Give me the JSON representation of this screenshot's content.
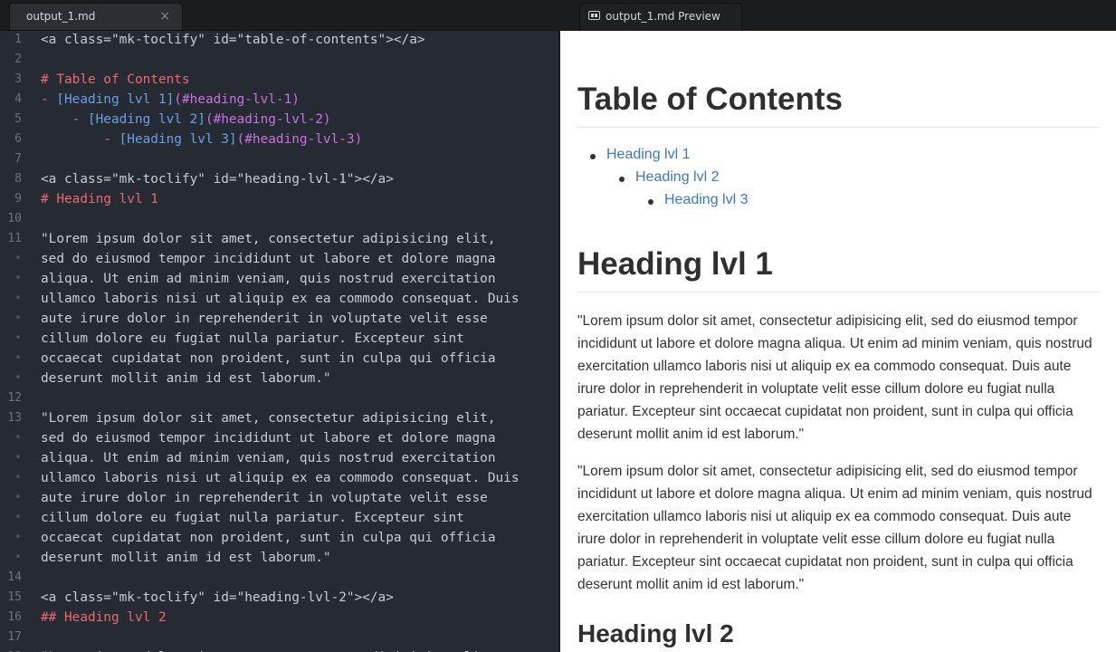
{
  "tabs": {
    "left": {
      "label": "output_1.md",
      "close": "×"
    },
    "right": {
      "label": "output_1.md Preview"
    }
  },
  "editor": {
    "lines": [
      {
        "n": "1",
        "segs": [
          [
            "text",
            "<a class=\"mk-toclify\" id=\"table-of-contents\"></a>"
          ]
        ]
      },
      {
        "n": "2",
        "segs": []
      },
      {
        "n": "3",
        "segs": [
          [
            "head",
            "# Table of Contents"
          ]
        ]
      },
      {
        "n": "4",
        "segs": [
          [
            "bullet",
            "- "
          ],
          [
            "link",
            "[Heading lvl 1]"
          ],
          [
            "url",
            "(#heading-lvl-1)"
          ]
        ]
      },
      {
        "n": "5",
        "segs": [
          [
            "text",
            "    "
          ],
          [
            "bullet",
            "- "
          ],
          [
            "link",
            "[Heading lvl 2]"
          ],
          [
            "url",
            "(#heading-lvl-2)"
          ]
        ]
      },
      {
        "n": "6",
        "segs": [
          [
            "text",
            "        "
          ],
          [
            "bullet",
            "- "
          ],
          [
            "link",
            "[Heading lvl 3]"
          ],
          [
            "url",
            "(#heading-lvl-3)"
          ]
        ]
      },
      {
        "n": "7",
        "segs": []
      },
      {
        "n": "8",
        "segs": [
          [
            "text",
            "<a class=\"mk-toclify\" id=\"heading-lvl-1\"></a>"
          ]
        ]
      },
      {
        "n": "9",
        "segs": [
          [
            "head",
            "# Heading lvl 1"
          ]
        ]
      },
      {
        "n": "10",
        "segs": []
      },
      {
        "n": "11",
        "segs": [
          [
            "text",
            "\"Lorem ipsum dolor sit amet, consectetur adipisicing elit,"
          ]
        ]
      },
      {
        "n": "•",
        "segs": [
          [
            "text",
            "sed do eiusmod tempor incididunt ut labore et dolore magna"
          ]
        ]
      },
      {
        "n": "•",
        "segs": [
          [
            "text",
            "aliqua. Ut enim ad minim veniam, quis nostrud exercitation"
          ]
        ]
      },
      {
        "n": "•",
        "segs": [
          [
            "text",
            "ullamco laboris nisi ut aliquip ex ea commodo consequat. Duis"
          ]
        ]
      },
      {
        "n": "•",
        "segs": [
          [
            "text",
            "aute irure dolor in reprehenderit in voluptate velit esse"
          ]
        ]
      },
      {
        "n": "•",
        "segs": [
          [
            "text",
            "cillum dolore eu fugiat nulla pariatur. Excepteur sint"
          ]
        ]
      },
      {
        "n": "•",
        "segs": [
          [
            "text",
            "occaecat cupidatat non proident, sunt in culpa qui officia"
          ]
        ]
      },
      {
        "n": "•",
        "segs": [
          [
            "text",
            "deserunt mollit anim id est laborum.\""
          ]
        ]
      },
      {
        "n": "12",
        "segs": []
      },
      {
        "n": "13",
        "segs": [
          [
            "text",
            "\"Lorem ipsum dolor sit amet, consectetur adipisicing elit,"
          ]
        ]
      },
      {
        "n": "•",
        "segs": [
          [
            "text",
            "sed do eiusmod tempor incididunt ut labore et dolore magna"
          ]
        ]
      },
      {
        "n": "•",
        "segs": [
          [
            "text",
            "aliqua. Ut enim ad minim veniam, quis nostrud exercitation"
          ]
        ]
      },
      {
        "n": "•",
        "segs": [
          [
            "text",
            "ullamco laboris nisi ut aliquip ex ea commodo consequat. Duis"
          ]
        ]
      },
      {
        "n": "•",
        "segs": [
          [
            "text",
            "aute irure dolor in reprehenderit in voluptate velit esse"
          ]
        ]
      },
      {
        "n": "•",
        "segs": [
          [
            "text",
            "cillum dolore eu fugiat nulla pariatur. Excepteur sint"
          ]
        ]
      },
      {
        "n": "•",
        "segs": [
          [
            "text",
            "occaecat cupidatat non proident, sunt in culpa qui officia"
          ]
        ]
      },
      {
        "n": "•",
        "segs": [
          [
            "text",
            "deserunt mollit anim id est laborum.\""
          ]
        ]
      },
      {
        "n": "14",
        "segs": []
      },
      {
        "n": "15",
        "segs": [
          [
            "text",
            "<a class=\"mk-toclify\" id=\"heading-lvl-2\"></a>"
          ]
        ]
      },
      {
        "n": "16",
        "segs": [
          [
            "head",
            "## Heading lvl 2"
          ]
        ]
      },
      {
        "n": "17",
        "segs": []
      },
      {
        "n": "18",
        "segs": [
          [
            "text",
            "\"Lorem ipsum dolor sit amet, consectetur adipisicing elit,"
          ]
        ]
      }
    ]
  },
  "preview": {
    "toc_title": "Table of Contents",
    "toc": [
      {
        "label": "Heading lvl 1"
      },
      {
        "label": "Heading lvl 2"
      },
      {
        "label": "Heading lvl 3"
      }
    ],
    "h1": "Heading lvl 1",
    "para1": "\"Lorem ipsum dolor sit amet, consectetur adipisicing elit, sed do eiusmod tempor incididunt ut labore et dolore magna aliqua. Ut enim ad minim veniam, quis nostrud exercitation ullamco laboris nisi ut aliquip ex ea commodo consequat. Duis aute irure dolor in reprehenderit in voluptate velit esse cillum dolore eu fugiat nulla pariatur. Excepteur sint occaecat cupidatat non proident, sunt in culpa qui officia deserunt mollit anim id est laborum.\"",
    "para2": "\"Lorem ipsum dolor sit amet, consectetur adipisicing elit, sed do eiusmod tempor incididunt ut labore et dolore magna aliqua. Ut enim ad minim veniam, quis nostrud exercitation ullamco laboris nisi ut aliquip ex ea commodo consequat. Duis aute irure dolor in reprehenderit in voluptate velit esse cillum dolore eu fugiat nulla pariatur. Excepteur sint occaecat cupidatat non proident, sunt in culpa qui officia deserunt mollit anim id est laborum.\"",
    "h2": "Heading lvl 2"
  }
}
